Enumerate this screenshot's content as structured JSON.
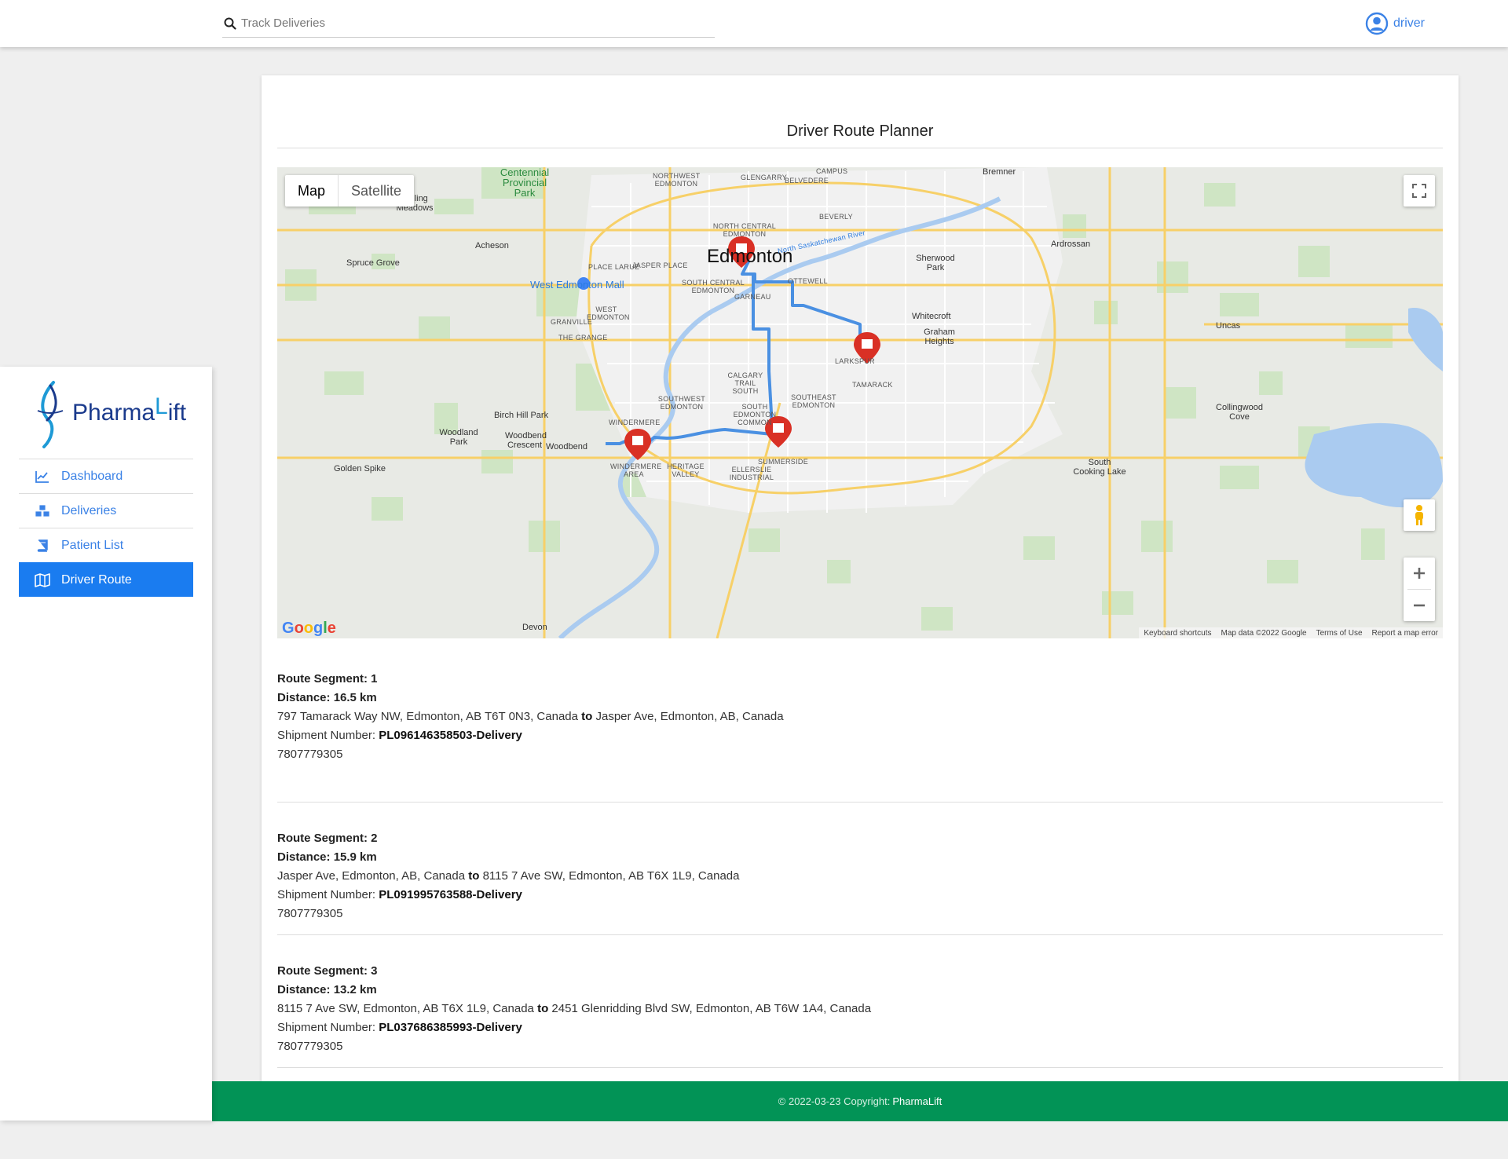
{
  "search": {
    "placeholder": "Track Deliveries"
  },
  "user": {
    "name": "driver"
  },
  "sidebar": {
    "logo": {
      "text_main": "Pharma",
      "text_l": "L",
      "text_rest": "ift"
    },
    "items": [
      {
        "label": "Dashboard",
        "icon": "chart-line-icon",
        "active": false
      },
      {
        "label": "Deliveries",
        "icon": "boxes-icon",
        "active": false
      },
      {
        "label": "Patient List",
        "icon": "book-icon",
        "active": false
      },
      {
        "label": "Driver Route",
        "icon": "map-icon",
        "active": true
      }
    ]
  },
  "page": {
    "title": "Driver Route Planner"
  },
  "map": {
    "type_map": "Map",
    "type_satellite": "Satellite",
    "google": "Google",
    "attribution": [
      "Keyboard shortcuts",
      "Map data ©2022 Google",
      "Terms of Use",
      "Report a map error"
    ],
    "labels": {
      "city": "Edmonton",
      "park": "Centennial Provincial Park",
      "spruce_grove": "Spruce Grove",
      "acheson": "Acheson",
      "wem": "West Edmonton Mall",
      "sherwood": "Sherwood Park",
      "ardrossan": "Ardrossan",
      "bremner": "Bremner",
      "whitecroft": "Whitecroft",
      "graham": "Graham Heights",
      "uncas": "Uncas",
      "collingwood": "Collingwood Cove",
      "south_cooking": "South Cooking Lake",
      "birch_hill": "Birch Hill Park",
      "woodland": "Woodland Park",
      "woodbend_cr": "Woodbend Crescent",
      "woodbend": "Woodbend",
      "golden_spike": "Golden Spike",
      "devon": "Devon",
      "rolling": "Rolling Meadows",
      "larkspur": "LARKSPUR",
      "tamarack": "TAMARACK",
      "summerside": "SUMMERSIDE",
      "windermere": "WINDERMERE",
      "windermere_area": "WINDERMERE AREA",
      "heritage": "HERITAGE VALLEY",
      "ellerslie": "ELLERSLIE INDUSTRIAL",
      "garneau": "GARNEAU",
      "ottewell": "OTTEWELL",
      "beverly": "BEVERLY",
      "campus": "CAMPUS",
      "belvedere": "BELVEDERE",
      "glengarry": "GLENGARRY",
      "nw_edmonton": "NORTHWEST EDMONTON",
      "nc_edmonton": "NORTH CENTRAL EDMONTON",
      "jasper_place": "JASPER PLACE",
      "place_larue": "PLACE LARUE",
      "sc_edmonton": "SOUTH CENTRAL EDMONTON",
      "w_edmonton": "WEST EDMONTON",
      "granville": "GRANVILLE",
      "the_grange": "THE GRANGE",
      "calgary_trail": "CALGARY TRAIL SOUTH",
      "sw_edmonton": "SOUTHWEST EDMONTON",
      "se_edmonton": "SOUTHEAST EDMONTON",
      "s_edmonton_common": "SOUTH EDMONTON COMMON",
      "river": "North Saskatchewan River"
    }
  },
  "segments": [
    {
      "heading": "Route Segment: 1",
      "distance": "Distance: 16.5 km",
      "from": "797 Tamarack Way NW, Edmonton, AB T6T 0N3, Canada",
      "to_word": "to",
      "to": "Jasper Ave, Edmonton, AB, Canada",
      "shipment_label": "Shipment Number:",
      "shipment": "PL096146358503-Delivery",
      "phone": "7807779305"
    },
    {
      "heading": "Route Segment: 2",
      "distance": "Distance: 15.9 km",
      "from": "Jasper Ave, Edmonton, AB, Canada",
      "to_word": "to",
      "to": "8115 7 Ave SW, Edmonton, AB T6X 1L9, Canada",
      "shipment_label": "Shipment Number:",
      "shipment": "PL091995763588-Delivery",
      "phone": "7807779305"
    },
    {
      "heading": "Route Segment: 3",
      "distance": "Distance: 13.2 km",
      "from": "8115 7 Ave SW, Edmonton, AB T6X 1L9, Canada",
      "to_word": "to",
      "to": "2451 Glenridding Blvd SW, Edmonton, AB T6W 1A4, Canada",
      "shipment_label": "Shipment Number:",
      "shipment": "PL037686385993-Delivery",
      "phone": "7807779305"
    }
  ],
  "footer": {
    "text": "© 2022-03-23 Copyright:",
    "brand": "PharmaLift"
  },
  "colors": {
    "primary": "#1a7cf0",
    "link": "#3b82e6",
    "footer": "#029356",
    "route": "#4a90e2",
    "marker": "#d93025"
  }
}
